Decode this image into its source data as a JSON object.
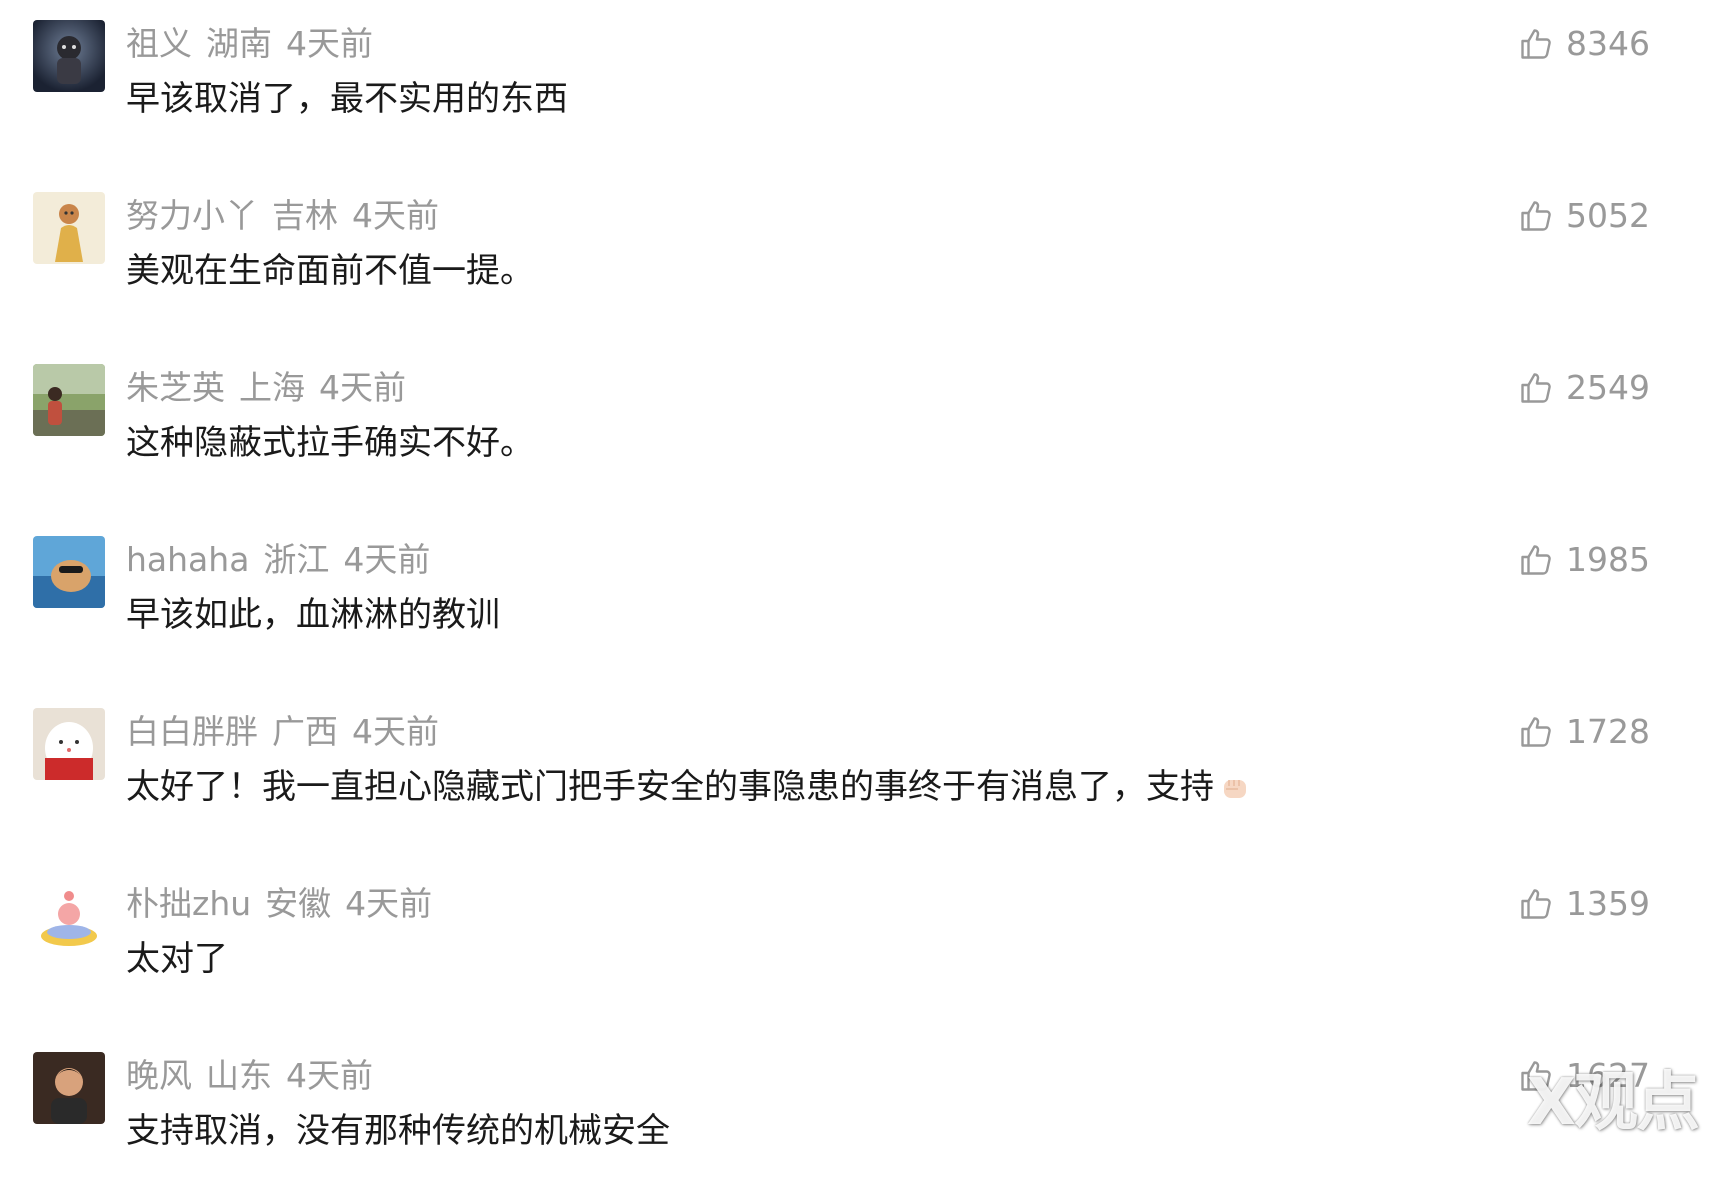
{
  "comments": [
    {
      "user": "祖义",
      "location": "湖南",
      "time": "4天前",
      "text": "早该取消了，最不实用的东西",
      "likes": "8346"
    },
    {
      "user": "努力小丫",
      "location": "吉林",
      "time": "4天前",
      "text": "美观在生命面前不值一提。",
      "likes": "5052"
    },
    {
      "user": "朱芝英",
      "location": "上海",
      "time": "4天前",
      "text": "这种隐蔽式拉手确实不好。",
      "likes": "2549"
    },
    {
      "user": "hahaha",
      "location": "浙江",
      "time": "4天前",
      "text": "早该如此，血淋淋的教训",
      "likes": "1985"
    },
    {
      "user": "白白胖胖",
      "location": "广西",
      "time": "4天前",
      "text": "太好了！我一直担心隐藏式门把手安全的事隐患的事终于有消息了，支持",
      "likes": "1728",
      "emoji": "fist-emoji"
    },
    {
      "user": "朴拙zhu",
      "location": "安徽",
      "time": "4天前",
      "text": "太对了",
      "likes": "1359"
    },
    {
      "user": "晚风",
      "location": "山东",
      "time": "4天前",
      "text": "支持取消，没有那种传统的机械安全",
      "likes": "1627"
    }
  ],
  "watermark": "X观点",
  "colors": {
    "meta": "#999999",
    "text": "#1a1a1a",
    "background": "#ffffff"
  }
}
